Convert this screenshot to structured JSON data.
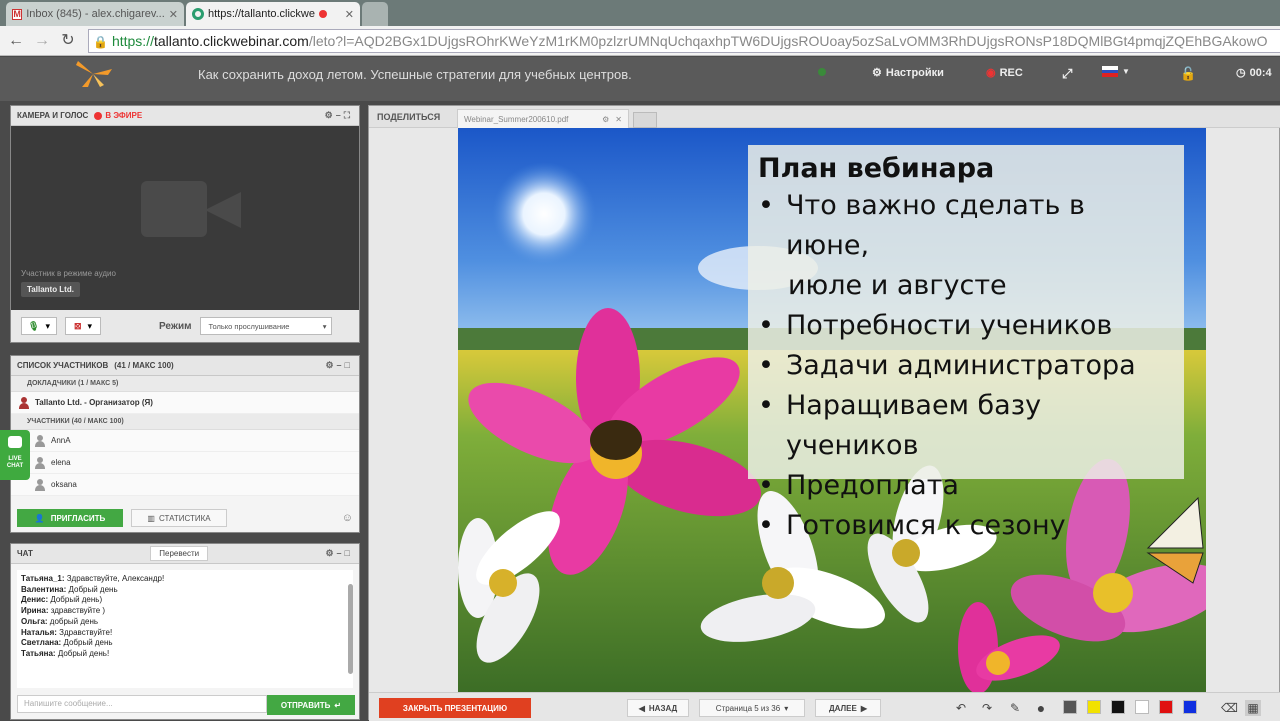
{
  "browser": {
    "tabs": [
      {
        "title": "Inbox (845) - alex.chigarev...",
        "icon": "gmail-icon"
      },
      {
        "title": "https://tallanto.clickwe",
        "icon": "tallanto-icon"
      }
    ],
    "url": {
      "scheme": "https://",
      "host": "tallanto.clickwebinar.com",
      "path": "/leto?l=AQD2BGx1DUjgsROhrKWeYzM1rKM0pzlzrUMNqUchqaxhpTW6DUjgsROUoay5ozSaLvOMM3RhDUjgsRONsP18DQMlBGt4pmqjZQEhBGAkowO"
    }
  },
  "app": {
    "title": "Как сохранить доход летом. Успешные стратегии для учебных центров.",
    "settings_label": "Настройки",
    "rec_label": "REC",
    "timer": "00:4"
  },
  "camera": {
    "header": "КАМЕРА И ГОЛОС",
    "live_label": "В ЭФИРЕ",
    "audio_mode_text": "Участник в режиме аудио",
    "name": "Tallanto Ltd.",
    "mode_label": "Режим",
    "mode_value": "Только прослушивание"
  },
  "participants": {
    "header": "СПИСОК УЧАСТНИКОВ",
    "count": "(41 / МАКС 100)",
    "speakers_section": "ДОКЛАДЧИКИ (1 / МАКС 5)",
    "organizer": "Tallanto Ltd. - Организатор (Я)",
    "participants_section": "УЧАСТНИКИ (40 / МАКС 100)",
    "list": [
      "AnnA",
      "elena",
      "oksana"
    ],
    "invite_label": "ПРИГЛАСИТЬ",
    "stats_label": "СТАТИСТИКА",
    "livechat_label": "LIVE CHAT"
  },
  "chat": {
    "header": "ЧАТ",
    "translate_label": "Перевести",
    "messages": [
      {
        "author": "Татьяна_1:",
        "text": " Здравствуйте, Александр!"
      },
      {
        "author": "Валентина:",
        "text": " Добрый день"
      },
      {
        "author": "Денис:",
        "text": " Добрый день)"
      },
      {
        "author": "Ирина:",
        "text": " здравствуйте )"
      },
      {
        "author": "Ольга:",
        "text": " добрый день"
      },
      {
        "author": "Наталья:",
        "text": " Здравствуйте!"
      },
      {
        "author": "Светлана:",
        "text": " Добрый день"
      },
      {
        "author": "Татьяна:",
        "text": " Добрый день!"
      }
    ],
    "input_placeholder": "Напишите сообщение...",
    "send_label": "ОТПРАВИТЬ"
  },
  "presentation": {
    "share_label": "ПОДЕЛИТЬСЯ",
    "doc_tab": "Webinar_Summer200610.pdf",
    "slide_title": "План вебинара",
    "bullets": [
      "Что важно сделать в июне,",
      "июле и августе",
      "Потребности учеников",
      "Задачи администратора",
      "Наращиваем базу учеников",
      "Предоплата",
      "Готовимся к сезону"
    ],
    "close_label": "ЗАКРЫТЬ ПРЕЗЕНТАЦИЮ",
    "back_label": "НАЗАД",
    "page_indicator": "Страница 5 из 36",
    "next_label": "ДАЛЕЕ",
    "palette": [
      "#555555",
      "#f2e200",
      "#111111",
      "#ffffff",
      "#e01010",
      "#1030e0"
    ]
  }
}
